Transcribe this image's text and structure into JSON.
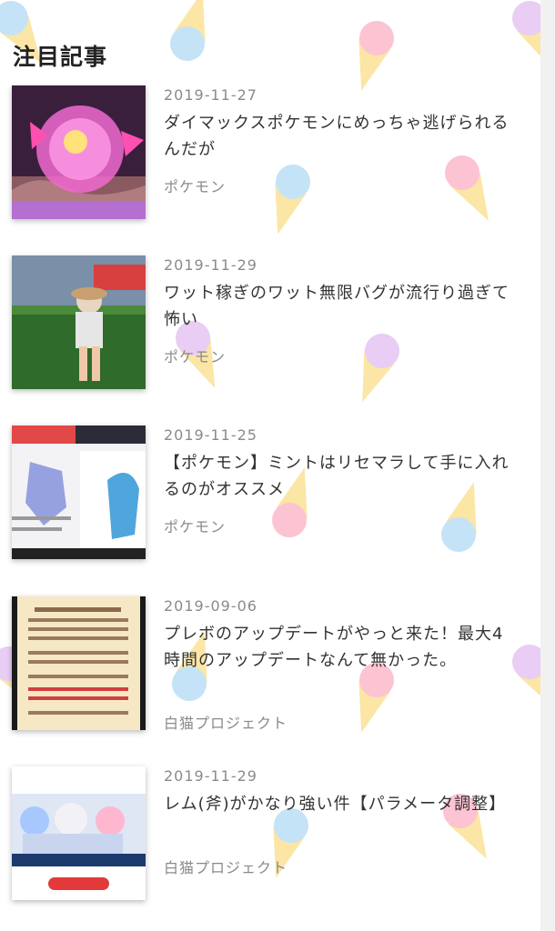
{
  "section": {
    "title": "注目記事"
  },
  "articles": [
    {
      "date": "2019-11-27",
      "title": "ダイマックスポケモンにめっちゃ逃げられるんだが",
      "category": "ポケモン",
      "thumb_icon": "dynamax-ball-thumbnail"
    },
    {
      "date": "2019-11-29",
      "title": "ワット稼ぎのワット無限バグが流行り過ぎて怖い",
      "category": "ポケモン",
      "thumb_icon": "stadium-trainer-thumbnail"
    },
    {
      "date": "2019-11-25",
      "title": "【ポケモン】ミントはリセマラして手に入れるのがオススメ",
      "category": "ポケモン",
      "thumb_icon": "stats-screen-thumbnail"
    },
    {
      "date": "2019-09-06",
      "title": "プレボのアップデートがやっと来た！最大4時間のアップデートなんて無かった。",
      "category": "白猫プロジェクト",
      "thumb_icon": "update-notice-thumbnail"
    },
    {
      "date": "2019-11-29",
      "title": "レム(斧)がかなり強い件【パラメータ調整】",
      "category": "白猫プロジェクト",
      "thumb_icon": "rezero-collab-thumbnail"
    }
  ]
}
